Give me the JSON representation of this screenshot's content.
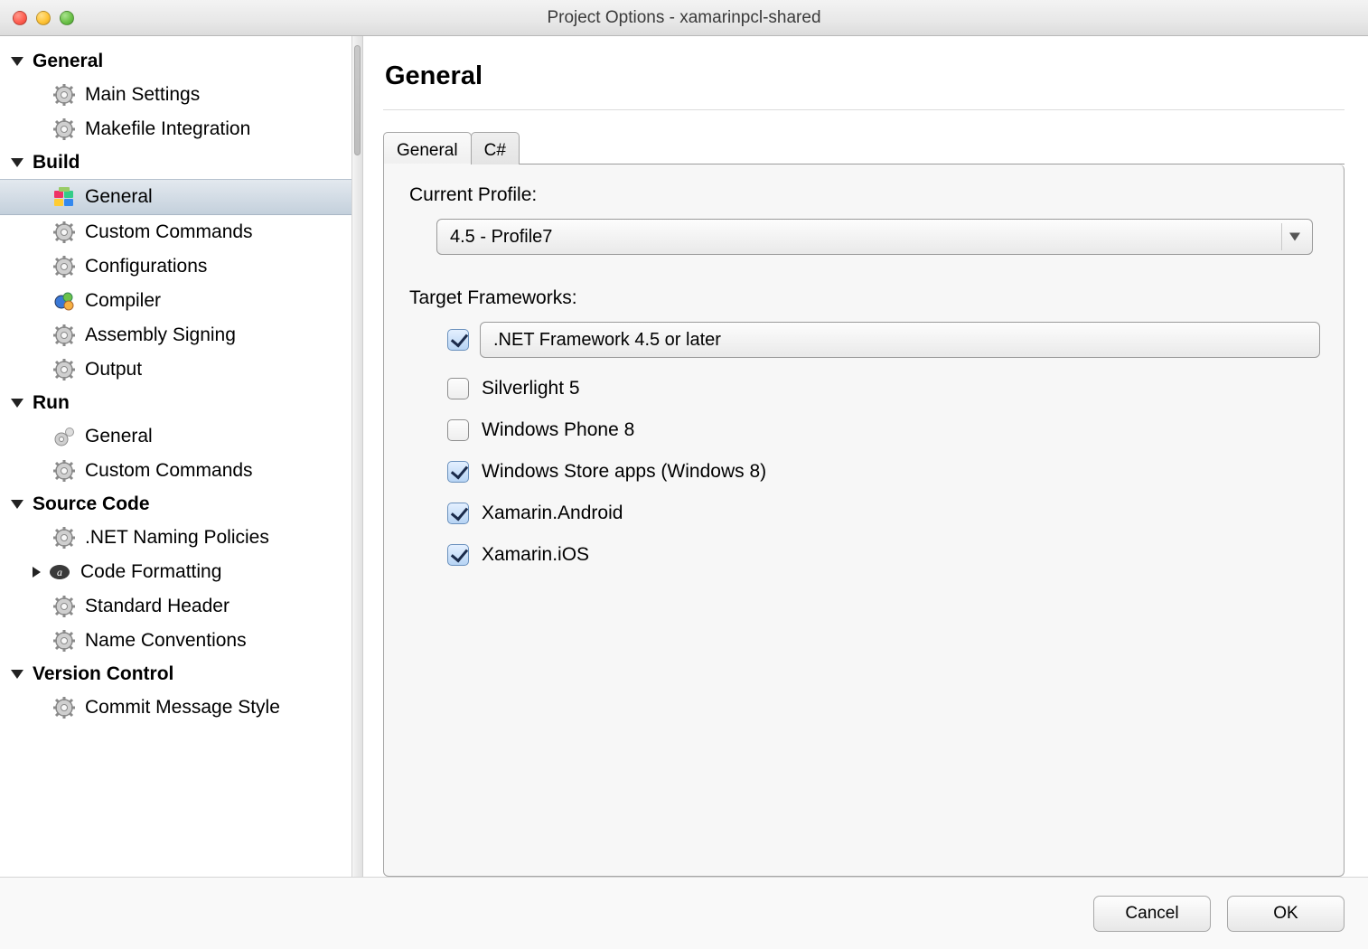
{
  "window": {
    "title": "Project Options - xamarinpcl-shared"
  },
  "sidebar": {
    "sections": [
      {
        "label": "General",
        "items": [
          {
            "label": "Main Settings",
            "icon": "gear-icon"
          },
          {
            "label": "Makefile Integration",
            "icon": "gear-icon"
          }
        ]
      },
      {
        "label": "Build",
        "items": [
          {
            "label": "General",
            "icon": "brick-icon",
            "selected": true
          },
          {
            "label": "Custom Commands",
            "icon": "gear-icon"
          },
          {
            "label": "Configurations",
            "icon": "gear-icon"
          },
          {
            "label": "Compiler",
            "icon": "compiler-icon"
          },
          {
            "label": "Assembly Signing",
            "icon": "gear-icon"
          },
          {
            "label": "Output",
            "icon": "gear-icon"
          }
        ]
      },
      {
        "label": "Run",
        "items": [
          {
            "label": "General",
            "icon": "gear-small-icon"
          },
          {
            "label": "Custom Commands",
            "icon": "gear-icon"
          }
        ]
      },
      {
        "label": "Source Code",
        "items": [
          {
            "label": ".NET Naming Policies",
            "icon": "gear-icon"
          },
          {
            "label": "Code Formatting",
            "icon": "formatting-icon",
            "expandable": true
          },
          {
            "label": "Standard Header",
            "icon": "gear-icon"
          },
          {
            "label": "Name Conventions",
            "icon": "gear-icon"
          }
        ]
      },
      {
        "label": "Version Control",
        "items": [
          {
            "label": "Commit Message Style",
            "icon": "gear-icon"
          }
        ]
      }
    ]
  },
  "main": {
    "title": "General",
    "tabs": [
      {
        "label": "General",
        "active": true
      },
      {
        "label": "C#",
        "active": false
      }
    ],
    "profile_label": "Current Profile:",
    "profile_value": "4.5 - Profile7",
    "targets_label": "Target Frameworks:",
    "targets": [
      {
        "label": ".NET Framework 4.5 or later",
        "checked": true,
        "isSelect": true
      },
      {
        "label": "Silverlight 5",
        "checked": false
      },
      {
        "label": "Windows Phone 8",
        "checked": false
      },
      {
        "label": "Windows Store apps (Windows 8)",
        "checked": true
      },
      {
        "label": "Xamarin.Android",
        "checked": true
      },
      {
        "label": "Xamarin.iOS",
        "checked": true
      }
    ]
  },
  "footer": {
    "cancel": "Cancel",
    "ok": "OK"
  }
}
